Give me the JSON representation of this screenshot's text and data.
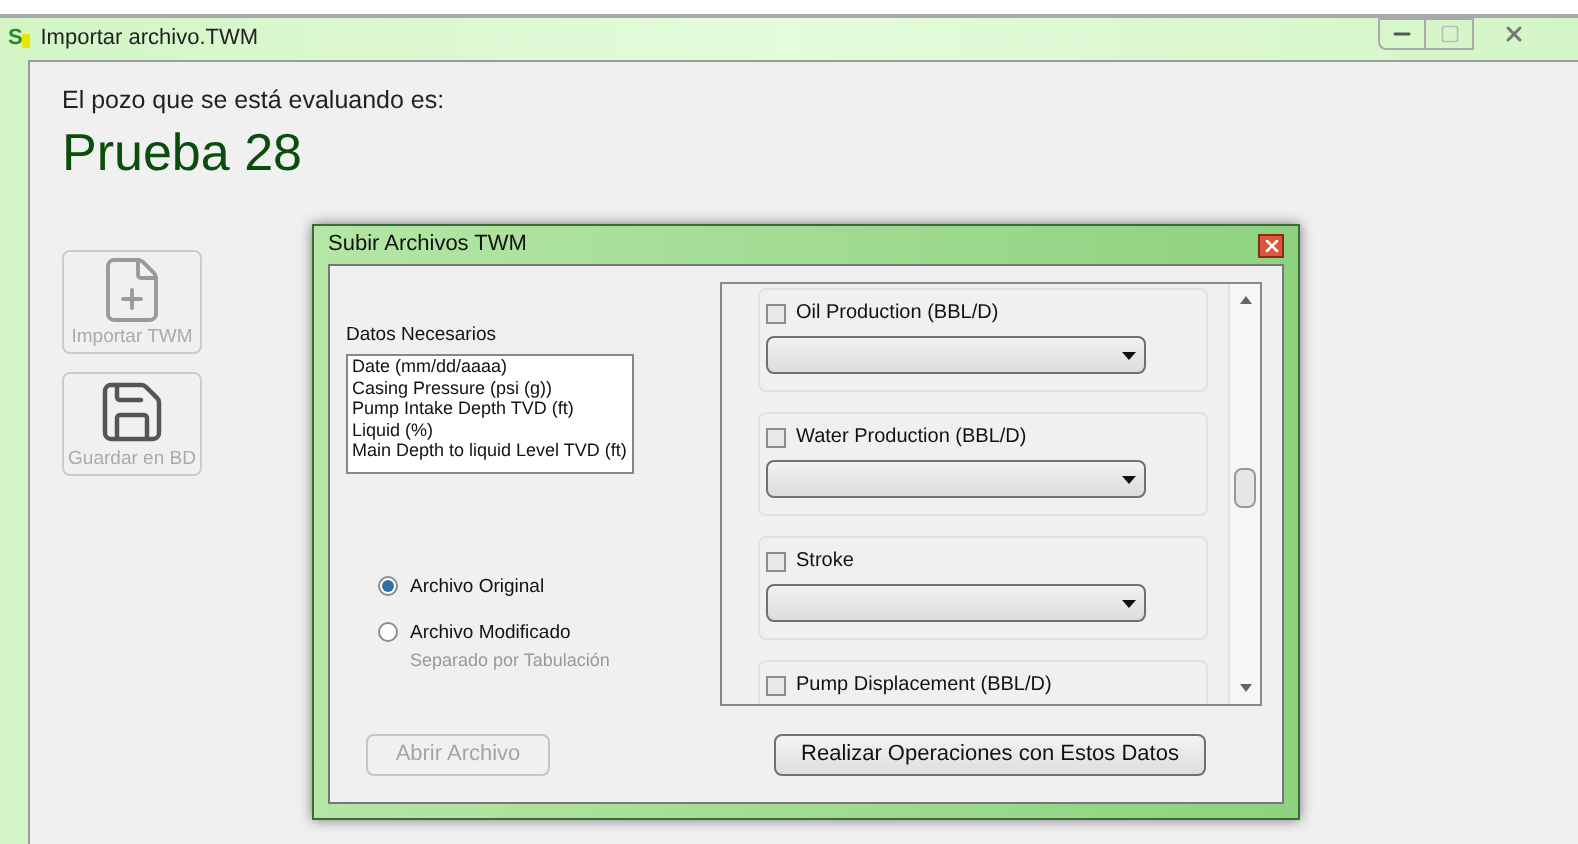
{
  "window": {
    "title": "Importar archivo.TWM",
    "logo": "S"
  },
  "well_label": "El pozo que se está evaluando es:",
  "well_name": "Prueba 28",
  "side_buttons": [
    {
      "label": "Importar TWM",
      "kind": "import",
      "disabled": true
    },
    {
      "label": "Guardar en BD",
      "kind": "save",
      "disabled": true
    }
  ],
  "dialog": {
    "title": "Subir Archivos TWM",
    "required_label": "Datos Necesarios",
    "required_list": [
      "Date (mm/dd/aaaa)",
      "Casing Pressure (psi (g))",
      "Pump Intake Depth TVD (ft)",
      "Liquid (%)",
      "Main Depth to liquid Level TVD (ft)"
    ],
    "file_options": [
      {
        "label": "Archivo Original",
        "selected": true
      },
      {
        "label": "Archivo Modificado",
        "note": "Separado por Tabulación",
        "selected": false
      }
    ],
    "open_button": {
      "label": "Abrir Archivo",
      "disabled": true
    },
    "fields": [
      {
        "label": "Oil Production (BBL/D)",
        "checked": false
      },
      {
        "label": "Water Production (BBL/D)",
        "checked": false
      },
      {
        "label": "Stroke",
        "checked": false
      },
      {
        "label": "Pump Displacement (BBL/D)",
        "checked": false
      }
    ],
    "submit_button": {
      "label": "Realizar Operaciones con Estos Datos",
      "disabled": false
    }
  }
}
